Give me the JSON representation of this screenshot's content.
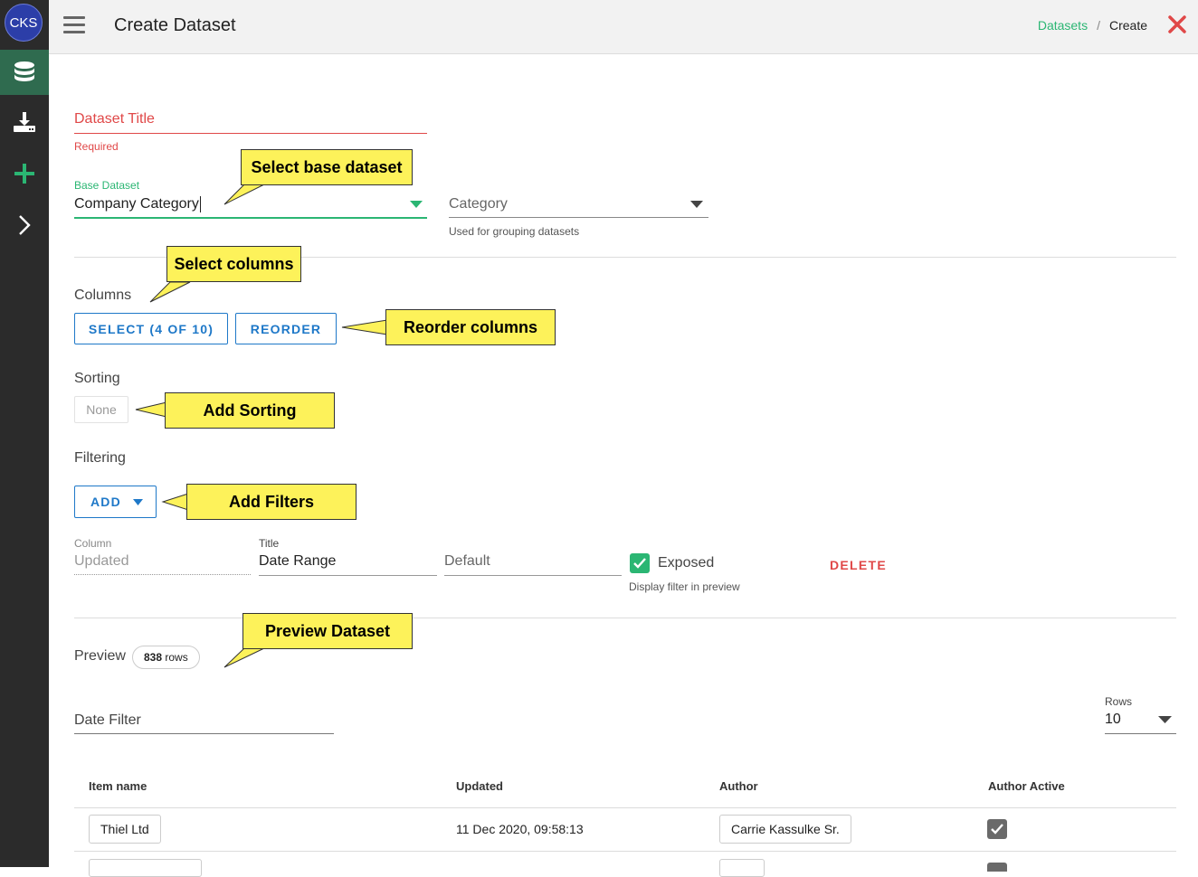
{
  "sidebar": {
    "avatar_initials": "CKS",
    "items": [
      {
        "icon": "database-icon",
        "active": true
      },
      {
        "icon": "download-icon",
        "active": false
      },
      {
        "icon": "plus-icon",
        "active": false
      },
      {
        "icon": "chevron-right-icon",
        "active": false
      }
    ]
  },
  "header": {
    "title": "Create Dataset",
    "breadcrumb": {
      "link": "Datasets",
      "separator": "/",
      "current": "Create"
    }
  },
  "form": {
    "dataset_title": {
      "placeholder": "Dataset Title",
      "helper": "Required"
    },
    "base_dataset": {
      "label": "Base Dataset",
      "value": "Company Category"
    },
    "category": {
      "placeholder": "Category",
      "helper": "Used for grouping datasets"
    },
    "columns": {
      "label": "Columns",
      "select_button": "SELECT (4 OF 10)",
      "reorder_button": "REORDER"
    },
    "sorting": {
      "label": "Sorting",
      "value": "None"
    },
    "filtering": {
      "label": "Filtering",
      "add_button": "ADD",
      "filter": {
        "column_label": "Column",
        "column_value": "Updated",
        "title_label": "Title",
        "title_value": "Date Range",
        "default_placeholder": "Default",
        "exposed_label": "Exposed",
        "exposed_checked": true,
        "exposed_helper": "Display filter in preview",
        "delete_button": "DELETE"
      }
    }
  },
  "preview": {
    "label": "Preview",
    "row_count": "838",
    "row_unit": "rows",
    "date_filter_label": "Date Filter",
    "rows_label": "Rows",
    "rows_value": "10",
    "table": {
      "headers": [
        "Item name",
        "Updated",
        "Author",
        "Author Active"
      ],
      "rows": [
        {
          "item_name": "Thiel Ltd",
          "updated": "11 Dec 2020, 09:58:13",
          "author": "Carrie Kassulke Sr.",
          "author_active": true
        }
      ]
    }
  },
  "callouts": {
    "base_dataset": "Select base dataset",
    "columns": "Select columns",
    "reorder": "Reorder columns",
    "sorting": "Add Sorting",
    "filters": "Add Filters",
    "preview": "Preview Dataset"
  },
  "colors": {
    "accent_green": "#2bb673",
    "error_red": "#e04848",
    "button_blue": "#1e78c8",
    "callout_yellow": "#fdf25a",
    "sidebar_bg": "#2b2b2b"
  }
}
